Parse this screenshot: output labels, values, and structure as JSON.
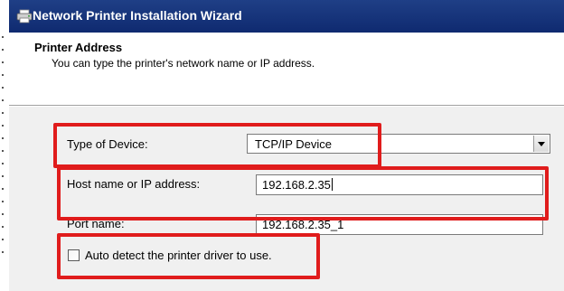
{
  "window": {
    "title": "Network Printer Installation Wizard",
    "icon": "printer-icon"
  },
  "header": {
    "title": "Printer Address",
    "description": "You can type the printer's network name or IP address."
  },
  "form": {
    "device_type": {
      "label": "Type of Device:",
      "value": "TCP/IP Device"
    },
    "host": {
      "label": "Host name or IP address:",
      "value": "192.168.2.35"
    },
    "port": {
      "label": "Port name:",
      "value": "192.168.2.35_1"
    },
    "auto_detect": {
      "label": "Auto detect the printer driver to use.",
      "checked": false
    }
  },
  "colors": {
    "titlebar": "#1f3f86",
    "dialog_bg": "#f0f0f0",
    "highlight": "#e01c1c"
  }
}
